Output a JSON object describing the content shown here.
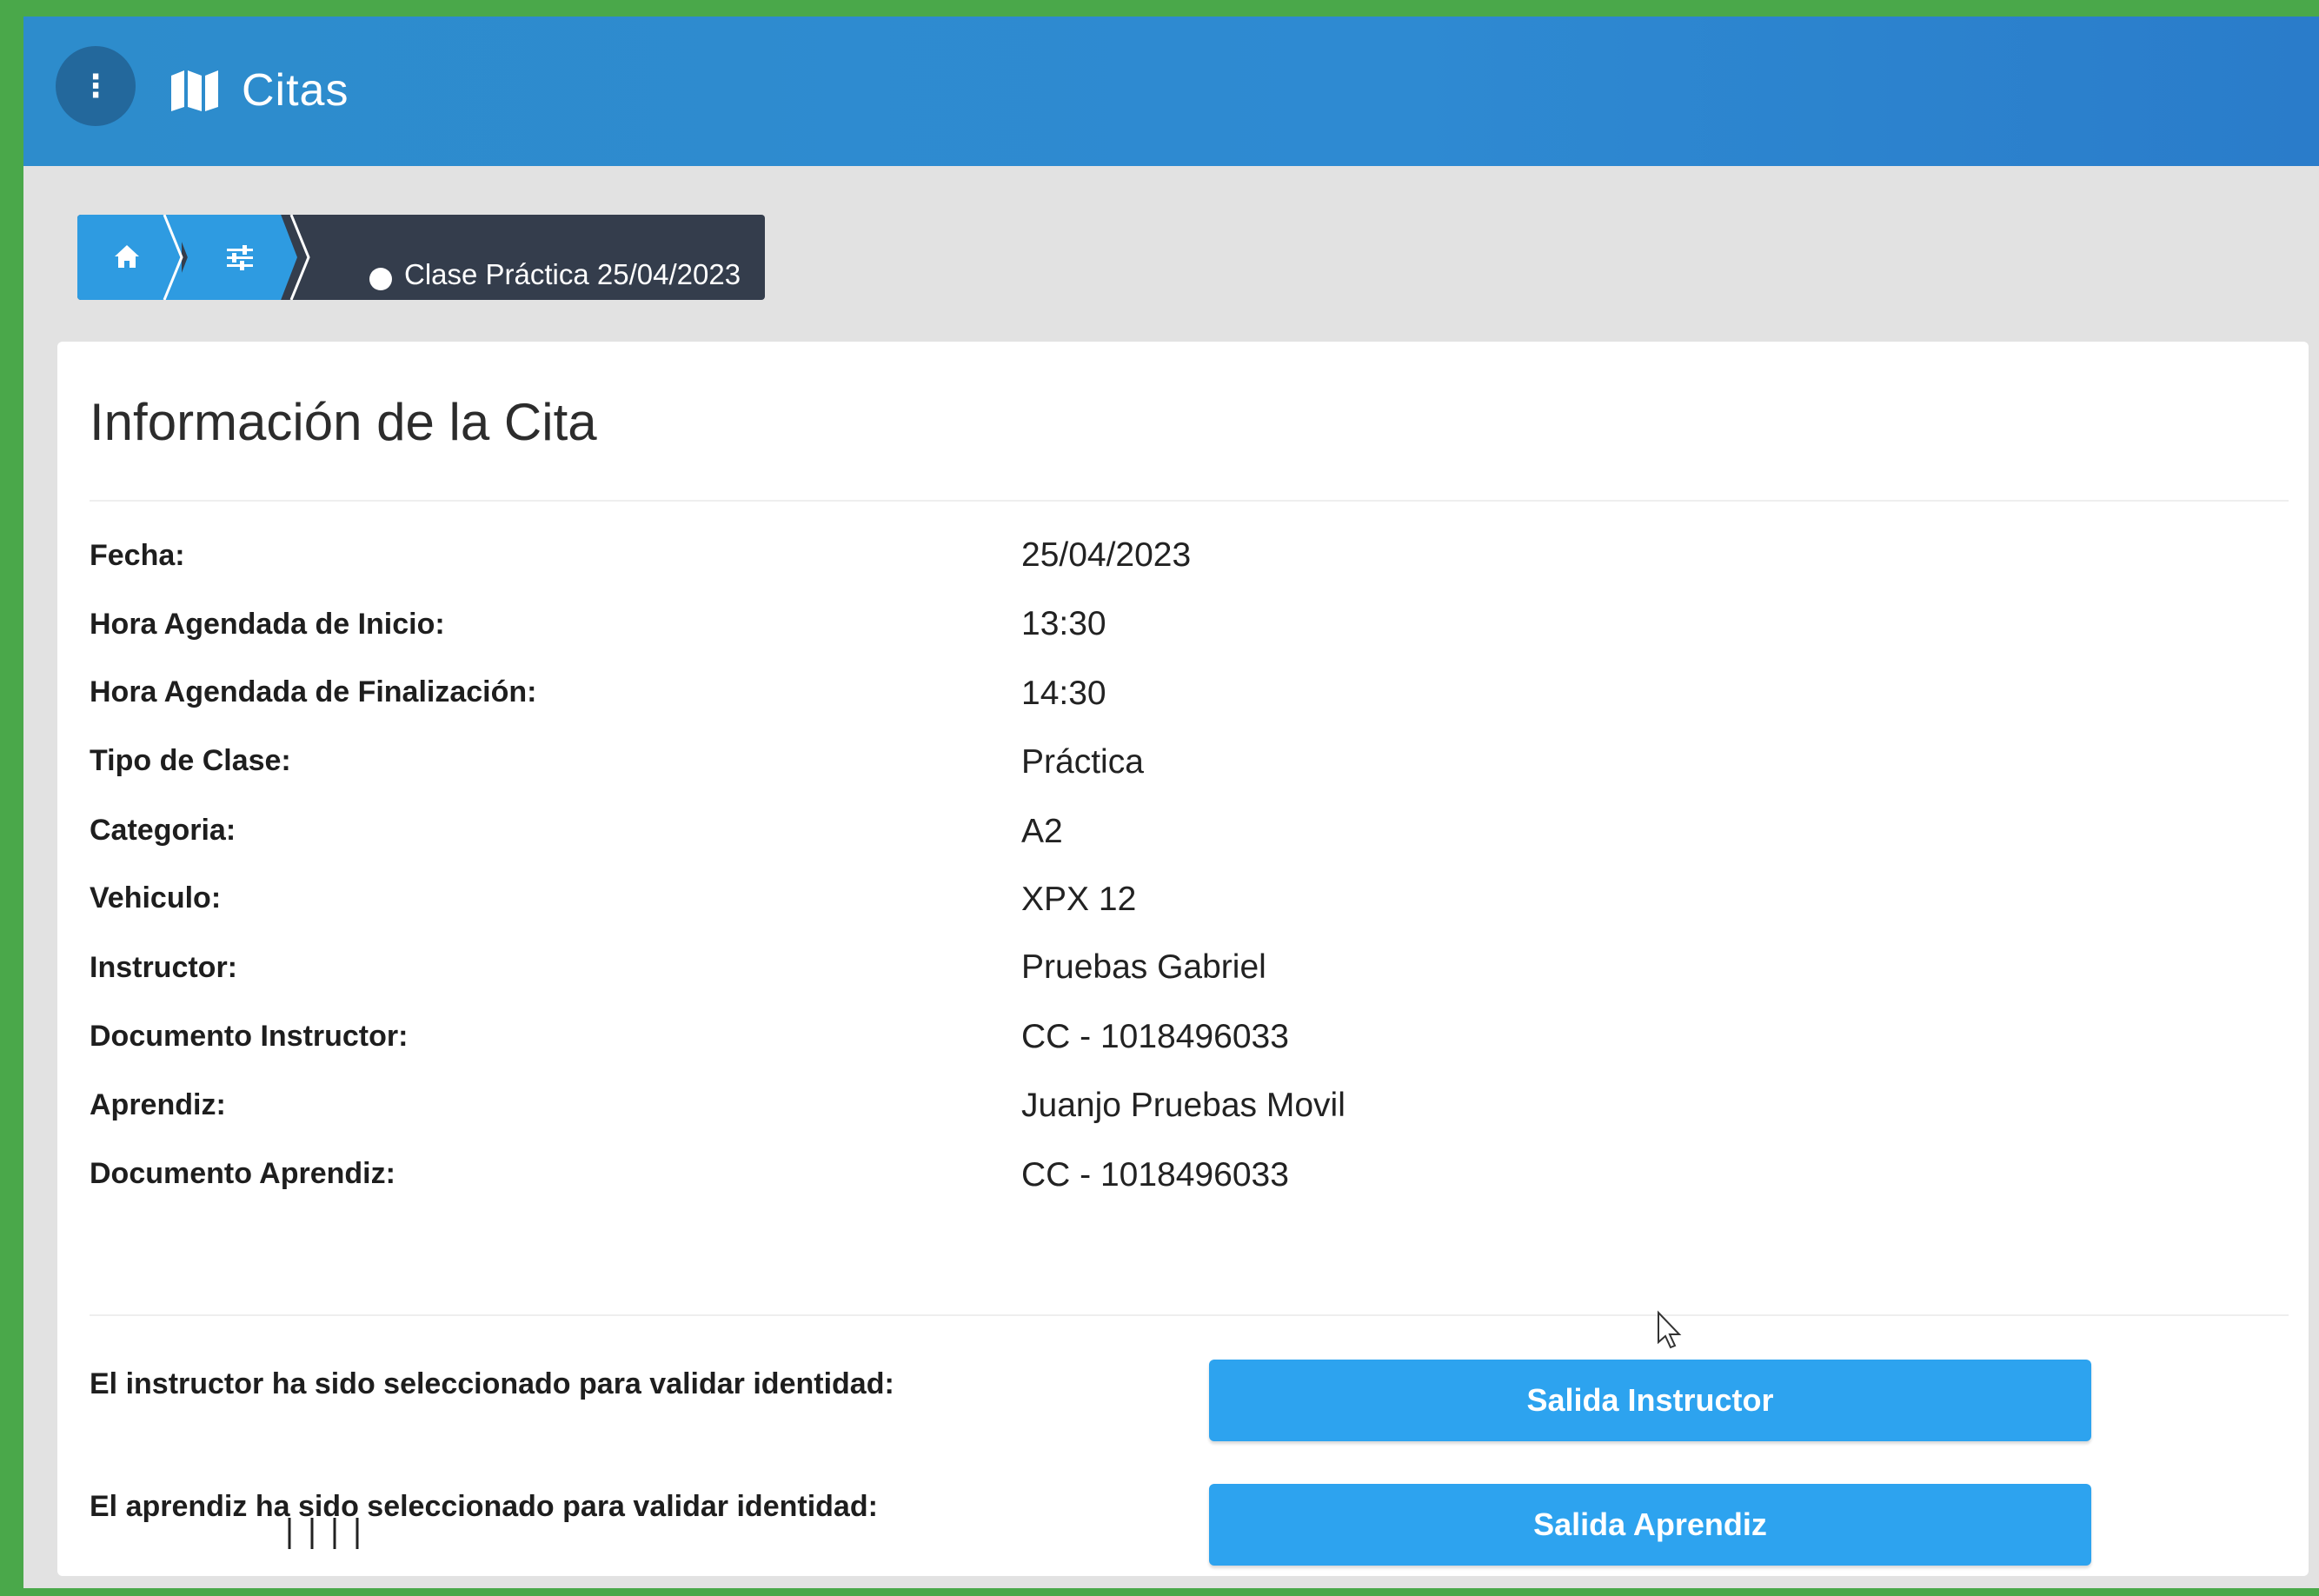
{
  "header": {
    "title": "Citas",
    "menu_icon": "more-vertical-icon",
    "app_icon": "map-icon",
    "bar_color": "#2e8ad2"
  },
  "breadcrumb": {
    "home_icon": "home-icon",
    "settings_icon": "sliders-icon",
    "current": "Clase Práctica 25/04/2023"
  },
  "card": {
    "title": "Información de la Cita",
    "fields": [
      {
        "label": "Fecha:",
        "value": "25/04/2023"
      },
      {
        "label": "Hora Agendada de Inicio:",
        "value": "13:30"
      },
      {
        "label": "Hora Agendada de Finalización:",
        "value": "14:30"
      },
      {
        "label": "Tipo de Clase:",
        "value": "Práctica"
      },
      {
        "label": "Categoria:",
        "value": "A2"
      },
      {
        "label": "Vehiculo:",
        "value": "XPX 12"
      },
      {
        "label": "Instructor:",
        "value": "Pruebas Gabriel"
      },
      {
        "label": "Documento Instructor:",
        "value": "CC - 1018496033"
      },
      {
        "label": "Aprendiz:",
        "value": "Juanjo Pruebas Movil"
      },
      {
        "label": "Documento Aprendiz:",
        "value": "CC - 1018496033"
      }
    ]
  },
  "validation": {
    "instructor_text": "El instructor ha sido seleccionado para validar identidad:",
    "instructor_button": "Salida Instructor",
    "aprendiz_text": "El aprendiz ha sido seleccionado para validar identidad:",
    "aprendiz_button": "Salida Aprendiz",
    "button_color": "#2da3ef"
  }
}
